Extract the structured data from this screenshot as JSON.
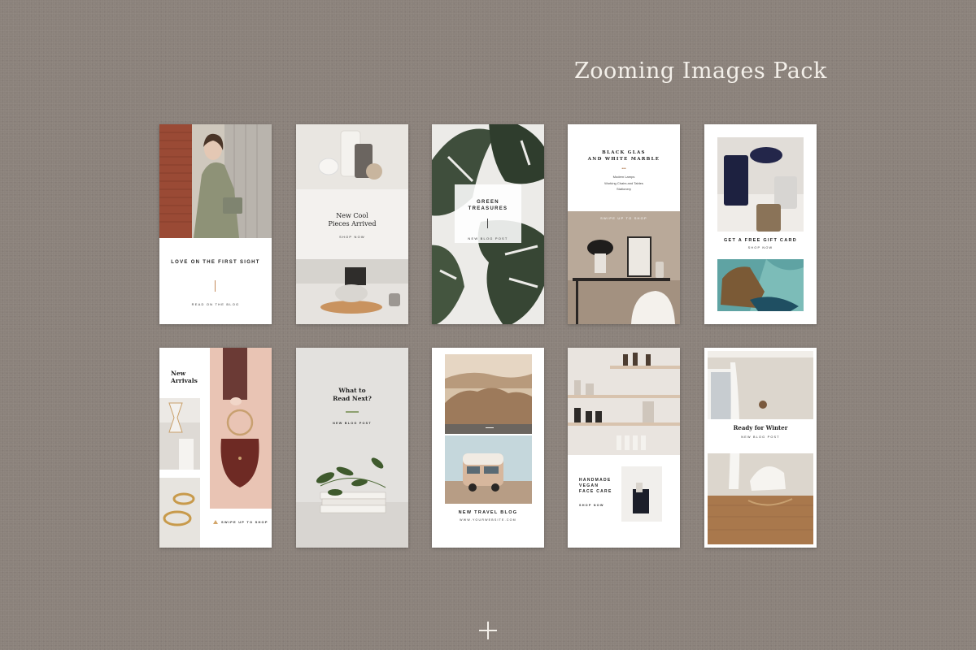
{
  "pack_title": "Zooming Images Pack",
  "cards": {
    "card1": {
      "heading": "LOVE ON\nTHE FIRST SIGHT",
      "cta": "READ ON THE BLOG"
    },
    "card2": {
      "heading": "New Cool\nPieces Arrived",
      "cta": "SHOP NOW"
    },
    "card3": {
      "heading": "GREEN\nTREASURES",
      "cta": "NEW BLOG POST"
    },
    "card4": {
      "heading": "BLACK GLAS\nAND WHITE MARBLE",
      "items": [
        "Modern Lamps",
        "Working Chairs and Tables",
        "Stationery"
      ],
      "cta": "SWIPE UP TO SHOP"
    },
    "card5": {
      "heading": "GET A FREE GIFT CARD",
      "cta": "SHOP NOW"
    },
    "card6": {
      "heading": "New\nArrivals",
      "cta": "SWIPE UP TO SHOP"
    },
    "card7": {
      "heading": "What to\nRead Next?",
      "cta": "NEW BLOG POST"
    },
    "card8": {
      "heading": "NEW TRAVEL BLOG",
      "cta": "WWW.YOURWEBSITE.COM"
    },
    "card9": {
      "heading": "HANDMADE\nVEGAN\nFACE CARE",
      "cta": "SHOP NOW"
    },
    "card10": {
      "heading": "Ready for Winter",
      "cta": "NEW BLOG POST"
    }
  },
  "icons": {
    "add": "plus-icon",
    "arrow": "triangle-arrow-icon"
  }
}
